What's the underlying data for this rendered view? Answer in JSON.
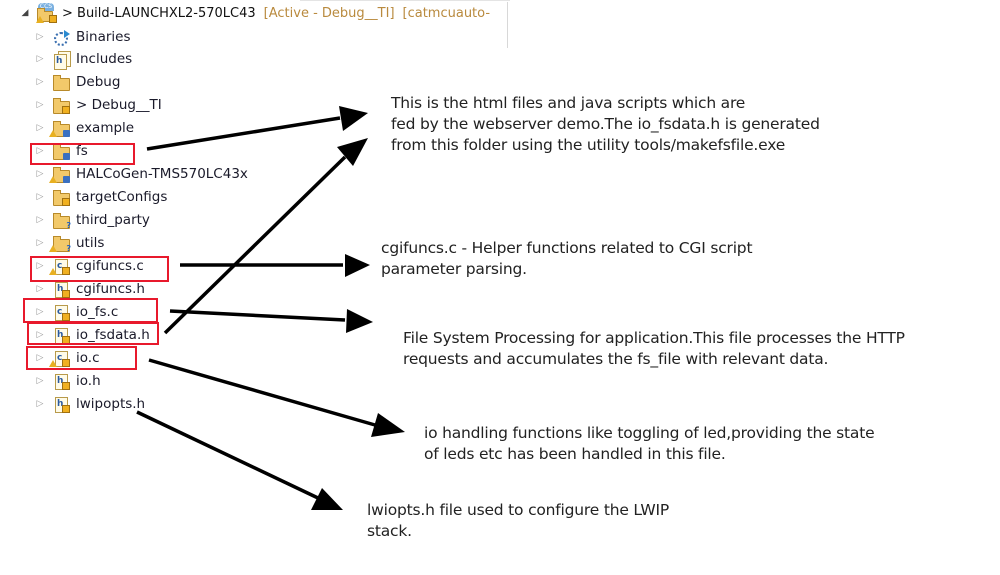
{
  "project": {
    "name": "> Build-LAUNCHXL2-570LC43",
    "status": "[Active - Debug__TI]",
    "extra": "[catmcuauto-",
    "icon": "ccs-project-icon"
  },
  "tree_items": [
    {
      "label": "Binaries",
      "icon": "binaries-icon",
      "highlighted": false
    },
    {
      "label": "Includes",
      "icon": "includes-icon",
      "highlighted": false
    },
    {
      "label": "Debug",
      "icon": "folder-icon",
      "highlighted": false
    },
    {
      "label": "> Debug__TI",
      "icon": "folder-locked-icon",
      "highlighted": false
    },
    {
      "label": "example",
      "icon": "folder-warning-icon",
      "highlighted": false
    },
    {
      "label": "fs",
      "icon": "folder-source-icon",
      "highlighted": true
    },
    {
      "label": "HALCoGen-TMS570LC43x",
      "icon": "folder-warning-icon",
      "highlighted": false
    },
    {
      "label": "targetConfigs",
      "icon": "folder-locked-icon",
      "highlighted": false
    },
    {
      "label": "third_party",
      "icon": "folder-unknown-icon",
      "highlighted": false
    },
    {
      "label": "utils",
      "icon": "folder-warning-unknown-icon",
      "highlighted": false
    },
    {
      "label": "cgifuncs.c",
      "icon": "c-file-warning-icon",
      "highlighted": true
    },
    {
      "label": "cgifuncs.h",
      "icon": "h-file-icon",
      "highlighted": false
    },
    {
      "label": "io_fs.c",
      "icon": "c-file-icon",
      "highlighted": true
    },
    {
      "label": "io_fsdata.h",
      "icon": "h-file-icon",
      "highlighted": true
    },
    {
      "label": "io.c",
      "icon": "c-file-warning-icon",
      "highlighted": true
    },
    {
      "label": "io.h",
      "icon": "h-file-icon",
      "highlighted": false
    },
    {
      "label": "lwipopts.h",
      "icon": "h-file-icon",
      "highlighted": false
    }
  ],
  "annotations": {
    "fs": [
      "This is the html files and java scripts which are",
      "fed by the webserver demo.The io_fsdata.h is generated",
      "from this folder using the utility  tools/makefsfile.exe"
    ],
    "cgifuncs": [
      "cgifuncs.c - Helper functions related to CGI script",
      "parameter parsing."
    ],
    "io_fs": [
      "File System Processing for application.This file processes the HTTP",
      "requests and accumulates the fs_file with relevant data."
    ],
    "io": [
      "io handling functions like toggling of led,providing the state",
      "of leds etc has been handled in this file."
    ],
    "lwipopts": [
      "lwiopts.h file used to configure the LWIP",
      "stack."
    ]
  },
  "colors": {
    "highlight_box": "#e8192c",
    "arrow": "#000000",
    "project_status": "#b98a3e"
  }
}
